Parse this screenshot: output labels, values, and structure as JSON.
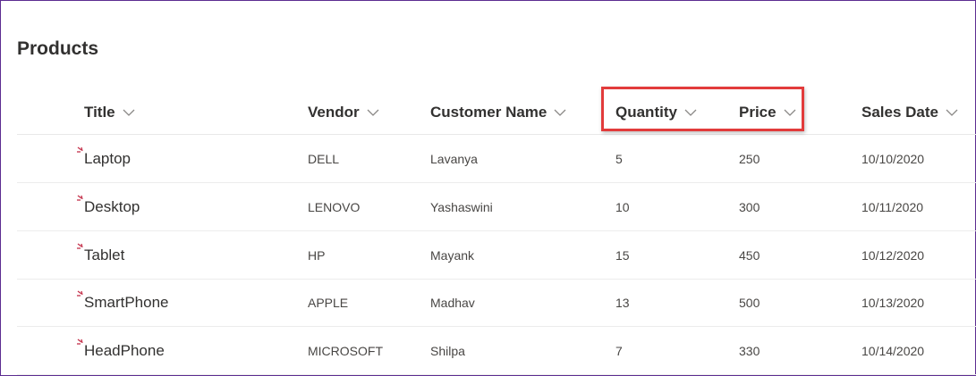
{
  "list": {
    "title": "Products"
  },
  "columns": [
    {
      "key": "title",
      "label": "Title"
    },
    {
      "key": "vendor",
      "label": "Vendor"
    },
    {
      "key": "customer",
      "label": "Customer Name"
    },
    {
      "key": "quantity",
      "label": "Quantity"
    },
    {
      "key": "price",
      "label": "Price"
    },
    {
      "key": "sales_date",
      "label": "Sales Date"
    }
  ],
  "rows": [
    {
      "title": "Laptop",
      "vendor": "DELL",
      "customer": "Lavanya",
      "quantity": "5",
      "price": "250",
      "sales_date": "10/10/2020"
    },
    {
      "title": "Desktop",
      "vendor": "LENOVO",
      "customer": "Yashaswini",
      "quantity": "10",
      "price": "300",
      "sales_date": "10/11/2020"
    },
    {
      "title": "Tablet",
      "vendor": "HP",
      "customer": "Mayank",
      "quantity": "15",
      "price": "450",
      "sales_date": "10/12/2020"
    },
    {
      "title": "SmartPhone",
      "vendor": "APPLE",
      "customer": "Madhav",
      "quantity": "13",
      "price": "500",
      "sales_date": "10/13/2020"
    },
    {
      "title": "HeadPhone",
      "vendor": "MICROSOFT",
      "customer": "Shilpa",
      "quantity": "7",
      "price": "330",
      "sales_date": "10/14/2020"
    }
  ],
  "colors": {
    "highlight": "#e23b3b",
    "new_indicator": "#c4314b",
    "frame_border": "#5c2d91"
  }
}
